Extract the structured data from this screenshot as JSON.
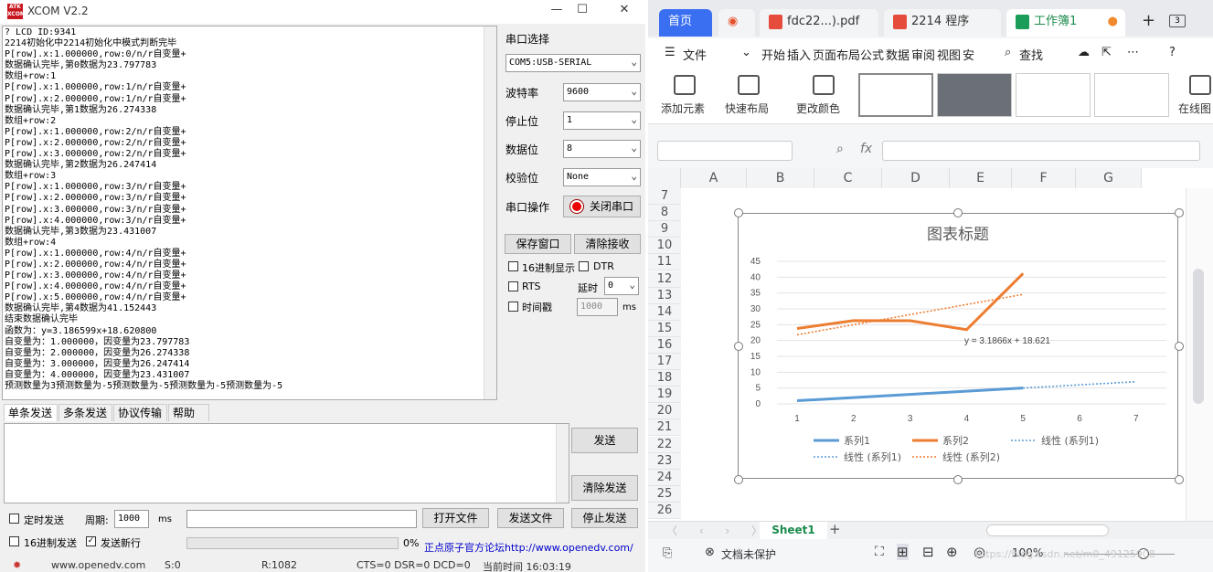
{
  "xcom": {
    "title": "XCOM V2.2",
    "logo": "ATK XCOM",
    "receive_lines": [
      "? LCD ID:9341",
      "2214初始化中2214初始化中模式判断完毕",
      "P[row].x:1.000000,row:0/n/r自变量+",
      "数据确认完毕,第0数据为23.797783",
      "数组+row:1",
      "P[row].x:1.000000,row:1/n/r自变量+",
      "P[row].x:2.000000,row:1/n/r自变量+",
      "数据确认完毕,第1数据为26.274338",
      "数组+row:2",
      "P[row].x:1.000000,row:2/n/r自变量+",
      "P[row].x:2.000000,row:2/n/r自变量+",
      "P[row].x:3.000000,row:2/n/r自变量+",
      "数据确认完毕,第2数据为26.247414",
      "数组+row:3",
      "P[row].x:1.000000,row:3/n/r自变量+",
      "P[row].x:2.000000,row:3/n/r自变量+",
      "P[row].x:3.000000,row:3/n/r自变量+",
      "P[row].x:4.000000,row:3/n/r自变量+",
      "数据确认完毕,第3数据为23.431007",
      "数组+row:4",
      "P[row].x:1.000000,row:4/n/r自变量+",
      "P[row].x:2.000000,row:4/n/r自变量+",
      "P[row].x:3.000000,row:4/n/r自变量+",
      "P[row].x:4.000000,row:4/n/r自变量+",
      "P[row].x:5.000000,row:4/n/r自变量+",
      "数据确认完毕,第4数据为41.152443",
      "结束数据确认完毕",
      "函数为：y=3.186599x+18.620800",
      "自变量为：1.000000，因变量为23.797783",
      "自变量为：2.000000，因变量为26.274338",
      "自变量为：3.000000，因变量为26.247414",
      "自变量为：4.000000，因变量为23.431007",
      "预测数量为3预测数量为-5预测数量为-5预测数量为-5预测数量为-5"
    ],
    "panel": {
      "port_select": "串口选择",
      "port_value": "COM5:USB-SERIAL",
      "baud_label": "波特率",
      "baud_value": "9600",
      "stop_label": "停止位",
      "stop_value": "1",
      "data_label": "数据位",
      "data_value": "8",
      "parity_label": "校验位",
      "parity_value": "None",
      "op_label": "串口操作",
      "op_button": "关闭串口",
      "save_window": "保存窗口",
      "clear_recv": "清除接收",
      "hex_display": "16进制显示",
      "dtr": "DTR",
      "rts": "RTS",
      "delay_label": "延时",
      "delay_value": "0",
      "timestamp": "时间戳",
      "ts_value": "1000",
      "ms": "ms"
    },
    "tabs": [
      "单条发送",
      "多条发送",
      "协议传输",
      "帮助"
    ],
    "send": "发送",
    "clear_send": "清除发送",
    "timed_send": "定时发送",
    "period_label": "周期:",
    "period_value": "1000",
    "period_ms": "ms",
    "open_file": "打开文件",
    "send_file": "发送文件",
    "stop_send": "停止发送",
    "hex_send": "16进制发送",
    "send_newline": "发送新行",
    "progress": "0%",
    "forum": "正点原子官方论坛http://www.openedv.com/",
    "status": {
      "site": "www.openedv.com",
      "s": "S:0",
      "r": "R:1082",
      "cts": "CTS=0 DSR=0 DCD=0",
      "time": "当前时间 16:03:19"
    }
  },
  "wps": {
    "tabs": [
      "首页",
      "fdc22...).pdf",
      "2214 程序",
      "工作簿1"
    ],
    "menu": [
      "文件",
      "开始",
      "插入",
      "页面布局",
      "公式",
      "数据",
      "审阅",
      "视图",
      "安"
    ],
    "search": "查找",
    "ribbon": [
      "添加元素",
      "快速布局",
      "更改颜色",
      "在线图"
    ],
    "columns": [
      "A",
      "B",
      "C",
      "D",
      "E",
      "F",
      "G"
    ],
    "rows": [
      "7",
      "8",
      "9",
      "10",
      "11",
      "12",
      "13",
      "14",
      "15",
      "16",
      "17",
      "18",
      "19",
      "20",
      "21",
      "22",
      "23",
      "24",
      "25",
      "26"
    ],
    "sheet": "Sheet1",
    "doc_protect": "文档未保护",
    "zoom": "100%",
    "watermark": "https://blog.csdn.net/m0_49125908"
  },
  "chart_data": {
    "type": "line",
    "title": "图表标题",
    "categories": [
      1,
      2,
      3,
      4,
      5,
      6,
      7
    ],
    "ylim": [
      0,
      45
    ],
    "yticks": [
      0,
      5,
      10,
      15,
      20,
      25,
      30,
      35,
      40,
      45
    ],
    "series": [
      {
        "name": "系列1",
        "color": "#5b9bd5",
        "values": [
          1,
          2,
          3,
          4,
          5
        ]
      },
      {
        "name": "系列2",
        "color": "#ed7d31",
        "values": [
          23.797783,
          26.274338,
          26.247414,
          23.431007,
          41.152443
        ]
      }
    ],
    "trendlines": [
      {
        "name": "线性 (系列1)",
        "color": "#5b9bd5",
        "x": [
          5,
          7
        ],
        "y": [
          5,
          7
        ]
      },
      {
        "name": "线性 (系列1)",
        "color": "#5b9bd5"
      },
      {
        "name": "线性 (系列2)",
        "color": "#ed7d31",
        "x": [
          1,
          5
        ],
        "y": [
          21.81,
          34.55
        ]
      }
    ],
    "equation": "y = 3.1866x + 18.621",
    "legend": "bottom",
    "grid": true
  }
}
